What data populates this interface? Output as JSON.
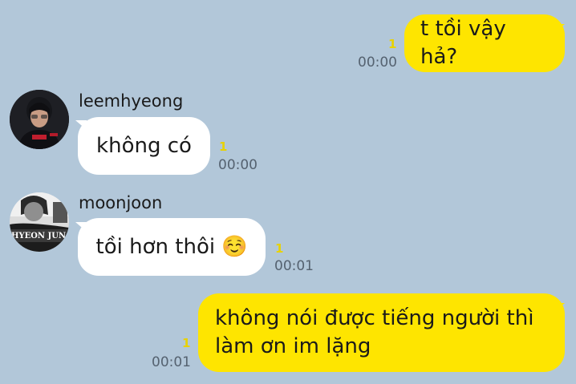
{
  "messages": [
    {
      "side": "me",
      "text": "t tồi vậy hả?",
      "unread": "1",
      "time": "00:00"
    },
    {
      "side": "other",
      "sender": "leemhyeong",
      "text": "không có",
      "unread": "1",
      "time": "00:00"
    },
    {
      "side": "other",
      "sender": "moonjoon",
      "text": "tồi hơn thôi",
      "emoji": "☺️",
      "unread": "1",
      "time": "00:01",
      "avatar_text": "HYEON JUN"
    },
    {
      "side": "me",
      "text_line1": "không nói được tiếng người thì",
      "text_line2": "làm ơn im lặng",
      "unread": "1",
      "time": "00:01"
    }
  ],
  "colors": {
    "background": "#b2c7d9",
    "my_bubble": "#fee500",
    "other_bubble": "#ffffff"
  }
}
